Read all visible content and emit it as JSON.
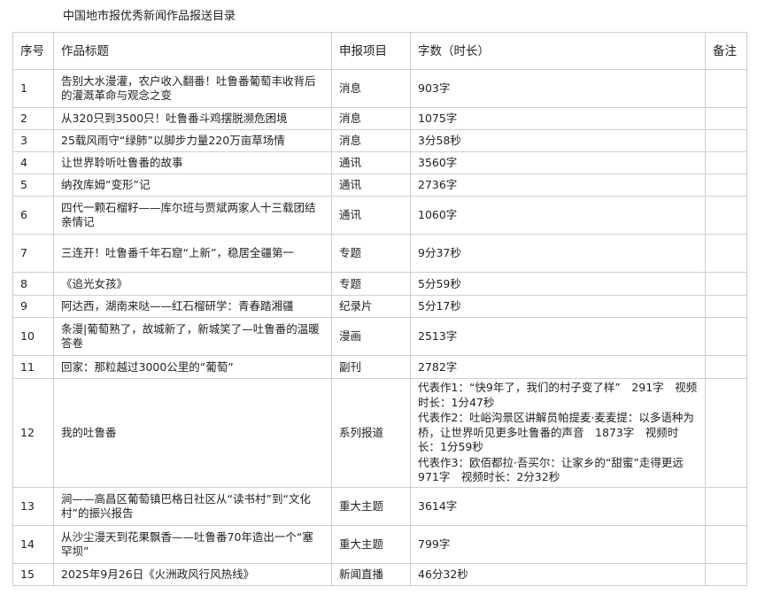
{
  "document": {
    "title": "中国地市报优秀新闻作品报送目录"
  },
  "table": {
    "headers": {
      "no": "序号",
      "title": "作品标题",
      "category": "申报项目",
      "count": "字数（时长）",
      "remark": "备注"
    },
    "rows": [
      {
        "no": "1",
        "title": "告别大水漫灌，农户收入翻番！吐鲁番葡萄丰收背后的灌溉革命与观念之变",
        "category": "消息",
        "count": "903字",
        "remark": ""
      },
      {
        "no": "2",
        "title": "从320只到3500只！吐鲁番斗鸡摆脱濒危困境",
        "category": "消息",
        "count": "1075字",
        "remark": ""
      },
      {
        "no": "3",
        "title": "25载风雨守“绿肺”以脚步力量220万亩草场情",
        "category": "消息",
        "count": "3分58秒",
        "remark": ""
      },
      {
        "no": "4",
        "title": "让世界聆听吐鲁番的故事",
        "category": "通讯",
        "count": "3560字",
        "remark": ""
      },
      {
        "no": "5",
        "title": "纳孜库姆“变形”记",
        "category": "通讯",
        "count": "2736字",
        "remark": ""
      },
      {
        "no": "6",
        "title": "四代一颗石榴籽——库尔班与贾斌两家人十三载团结亲情记",
        "category": "通讯",
        "count": "1060字",
        "remark": ""
      },
      {
        "no": "7",
        "title": "三连开！吐鲁番千年石窟“上新”，稳居全疆第一",
        "category": "专题",
        "count": "9分37秒",
        "remark": ""
      },
      {
        "no": "8",
        "title": "《追光女孩》",
        "category": "专题",
        "count": "5分59秒",
        "remark": ""
      },
      {
        "no": "9",
        "title": "阿达西，湖南来哒——红石榴研学：青春踏湘疆",
        "category": "纪录片",
        "count": "5分17秒",
        "remark": ""
      },
      {
        "no": "10",
        "title": "条漫|葡萄熟了，故城新了，新城笑了—吐鲁番的温暖答卷",
        "category": "漫画",
        "count": "2513字",
        "remark": ""
      },
      {
        "no": "11",
        "title": "回家：那粒越过3000公里的“葡萄”",
        "category": "副刊",
        "count": "2782字",
        "remark": ""
      },
      {
        "no": "12",
        "title": "我的吐鲁番",
        "category": "系列报道",
        "count_entries": [
          "代表作1：“快9年了，我们的村子变了样”　291字　视频时长：1分47秒",
          "代表作2：吐峪沟景区讲解员帕提麦·麦麦提：以多语种为桥，让世界听见更多吐鲁番的声音　1873字　视频时长：1分59秒",
          "代表作3：欧佰都拉·吾买尔：让家乡的“甜蜜”走得更远　971字　视频时长：2分32秒"
        ],
        "remark": ""
      },
      {
        "no": "13",
        "title": "涧——高昌区葡萄镇巴格日社区从“读书村”到“文化村”的振兴报告",
        "category": "重大主题",
        "count": "3614字",
        "remark": ""
      },
      {
        "no": "14",
        "title": "从沙尘漫天到花果飘香——吐鲁番70年造出一个“塞罕坝”",
        "category": "重大主题",
        "count": "799字",
        "remark": ""
      },
      {
        "no": "15",
        "title": "2025年9月26日《火洲政风行风热线》",
        "category": "新闻直播",
        "count": "46分32秒",
        "remark": ""
      }
    ]
  }
}
